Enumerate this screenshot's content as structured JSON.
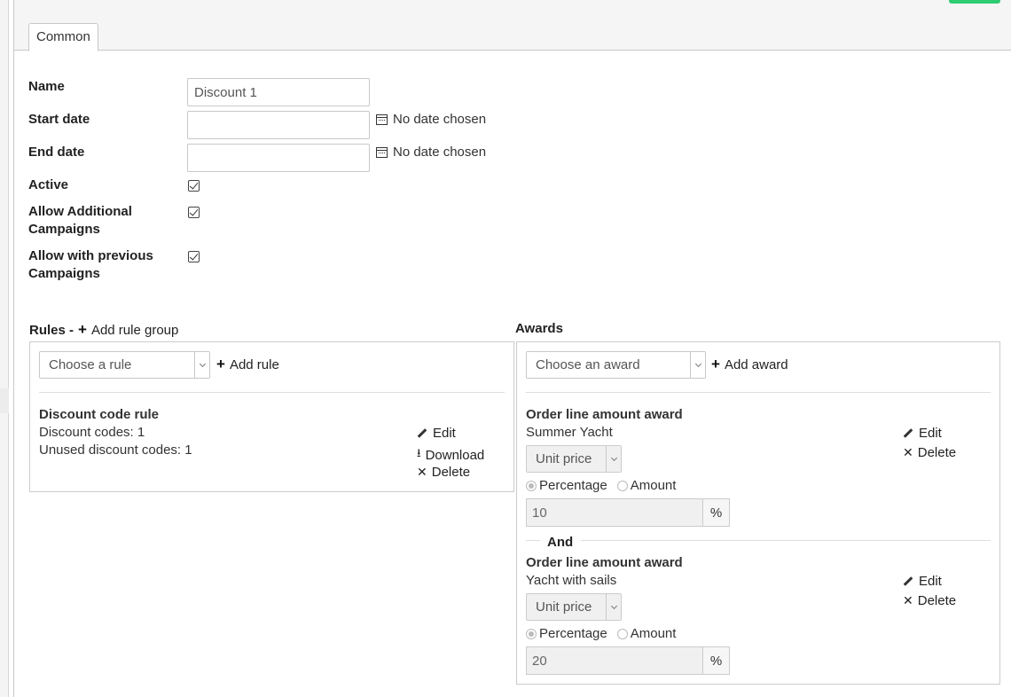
{
  "tabs": [
    {
      "label": "Common",
      "active": true
    }
  ],
  "form": {
    "name": {
      "label": "Name",
      "value": "Discount 1"
    },
    "start_date": {
      "label": "Start date",
      "value": "",
      "hint": "No date chosen"
    },
    "end_date": {
      "label": "End date",
      "value": "",
      "hint": "No date chosen"
    },
    "active": {
      "label": "Active",
      "checked": true
    },
    "allow_additional": {
      "label_line1": "Allow Additional",
      "label_line2": "Campaigns",
      "checked": true
    },
    "allow_previous": {
      "label_line1": "Allow with previous",
      "label_line2": "Campaigns",
      "checked": true
    }
  },
  "rules": {
    "title": "Rules -",
    "add_group": "Add rule group",
    "select_placeholder": "Choose a rule",
    "add_rule": "Add rule",
    "items": [
      {
        "title": "Discount code rule",
        "line1": "Discount codes: 1",
        "line2": "Unused discount codes: 1",
        "edit": "Edit",
        "download": "Download",
        "delete": "Delete"
      }
    ]
  },
  "awards": {
    "title": "Awards",
    "select_placeholder": "Choose an award",
    "add_award": "Add award",
    "separator": "And",
    "items": [
      {
        "title": "Order line amount award",
        "product": "Summer Yacht",
        "price_type": "Unit price",
        "opt_percentage": "Percentage",
        "opt_amount": "Amount",
        "selected": "Percentage",
        "value": "10",
        "unit": "%",
        "edit": "Edit",
        "delete": "Delete"
      },
      {
        "title": "Order line amount award",
        "product": "Yacht with sails",
        "price_type": "Unit price",
        "opt_percentage": "Percentage",
        "opt_amount": "Amount",
        "selected": "Percentage",
        "value": "20",
        "unit": "%",
        "edit": "Edit",
        "delete": "Delete"
      }
    ]
  },
  "colors": {
    "accent": "#2ecc71",
    "border": "#c8c8c8"
  }
}
